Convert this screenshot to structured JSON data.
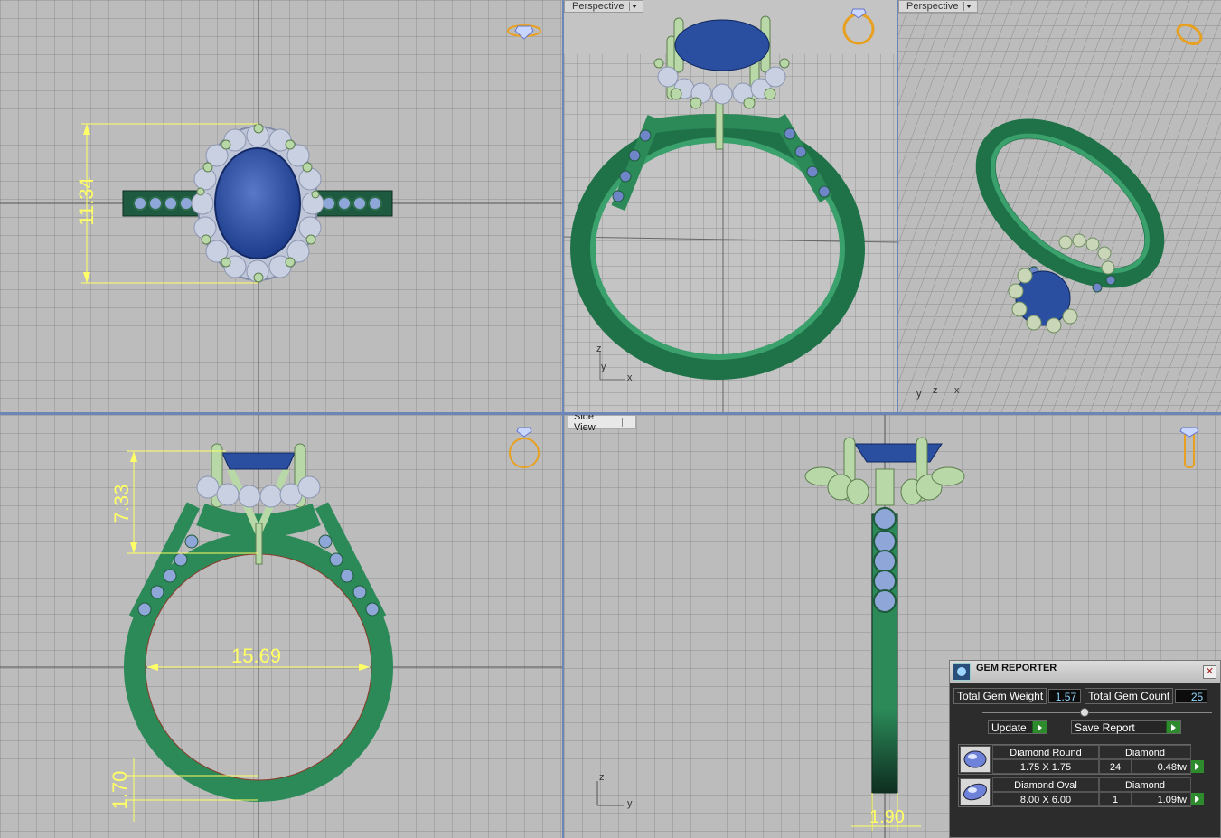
{
  "viewports": {
    "top_left": {
      "dimension": "11.34"
    },
    "top_mid": {
      "label": "Perspective"
    },
    "top_right": {
      "label": "Perspective"
    },
    "bottom_left": {
      "dim_height": "7.33",
      "dim_inner": "15.69",
      "dim_shank": "1.70"
    },
    "bottom_right": {
      "label": "Side View",
      "dim_width": "1.90"
    }
  },
  "axes": {
    "x": "x",
    "y": "y",
    "z": "z"
  },
  "gem_reporter": {
    "title": "GEM REPORTER",
    "close": "✕",
    "total_weight_label": "Total Gem Weight",
    "total_weight_value": "1.57",
    "total_count_label": "Total Gem Count",
    "total_count_value": "25",
    "update_label": "Update",
    "save_label": "Save Report",
    "gems": [
      {
        "name": "Diamond Round",
        "material": "Diamond",
        "size": "1.75 X 1.75",
        "count": "24",
        "weight": "0.48tw"
      },
      {
        "name": "Diamond Oval",
        "material": "Diamond",
        "size": "8.00 X 6.00",
        "count": "1",
        "weight": "1.09tw"
      }
    ]
  },
  "colors": {
    "metal_green": "#2f8f5c",
    "prong_green": "#b8d8a8",
    "sapphire": "#2a4ea0",
    "diamond": "#a9b8e0",
    "dimension": "#ffff66",
    "background": "#b9b9b9",
    "grid": "#8a8a8a"
  }
}
